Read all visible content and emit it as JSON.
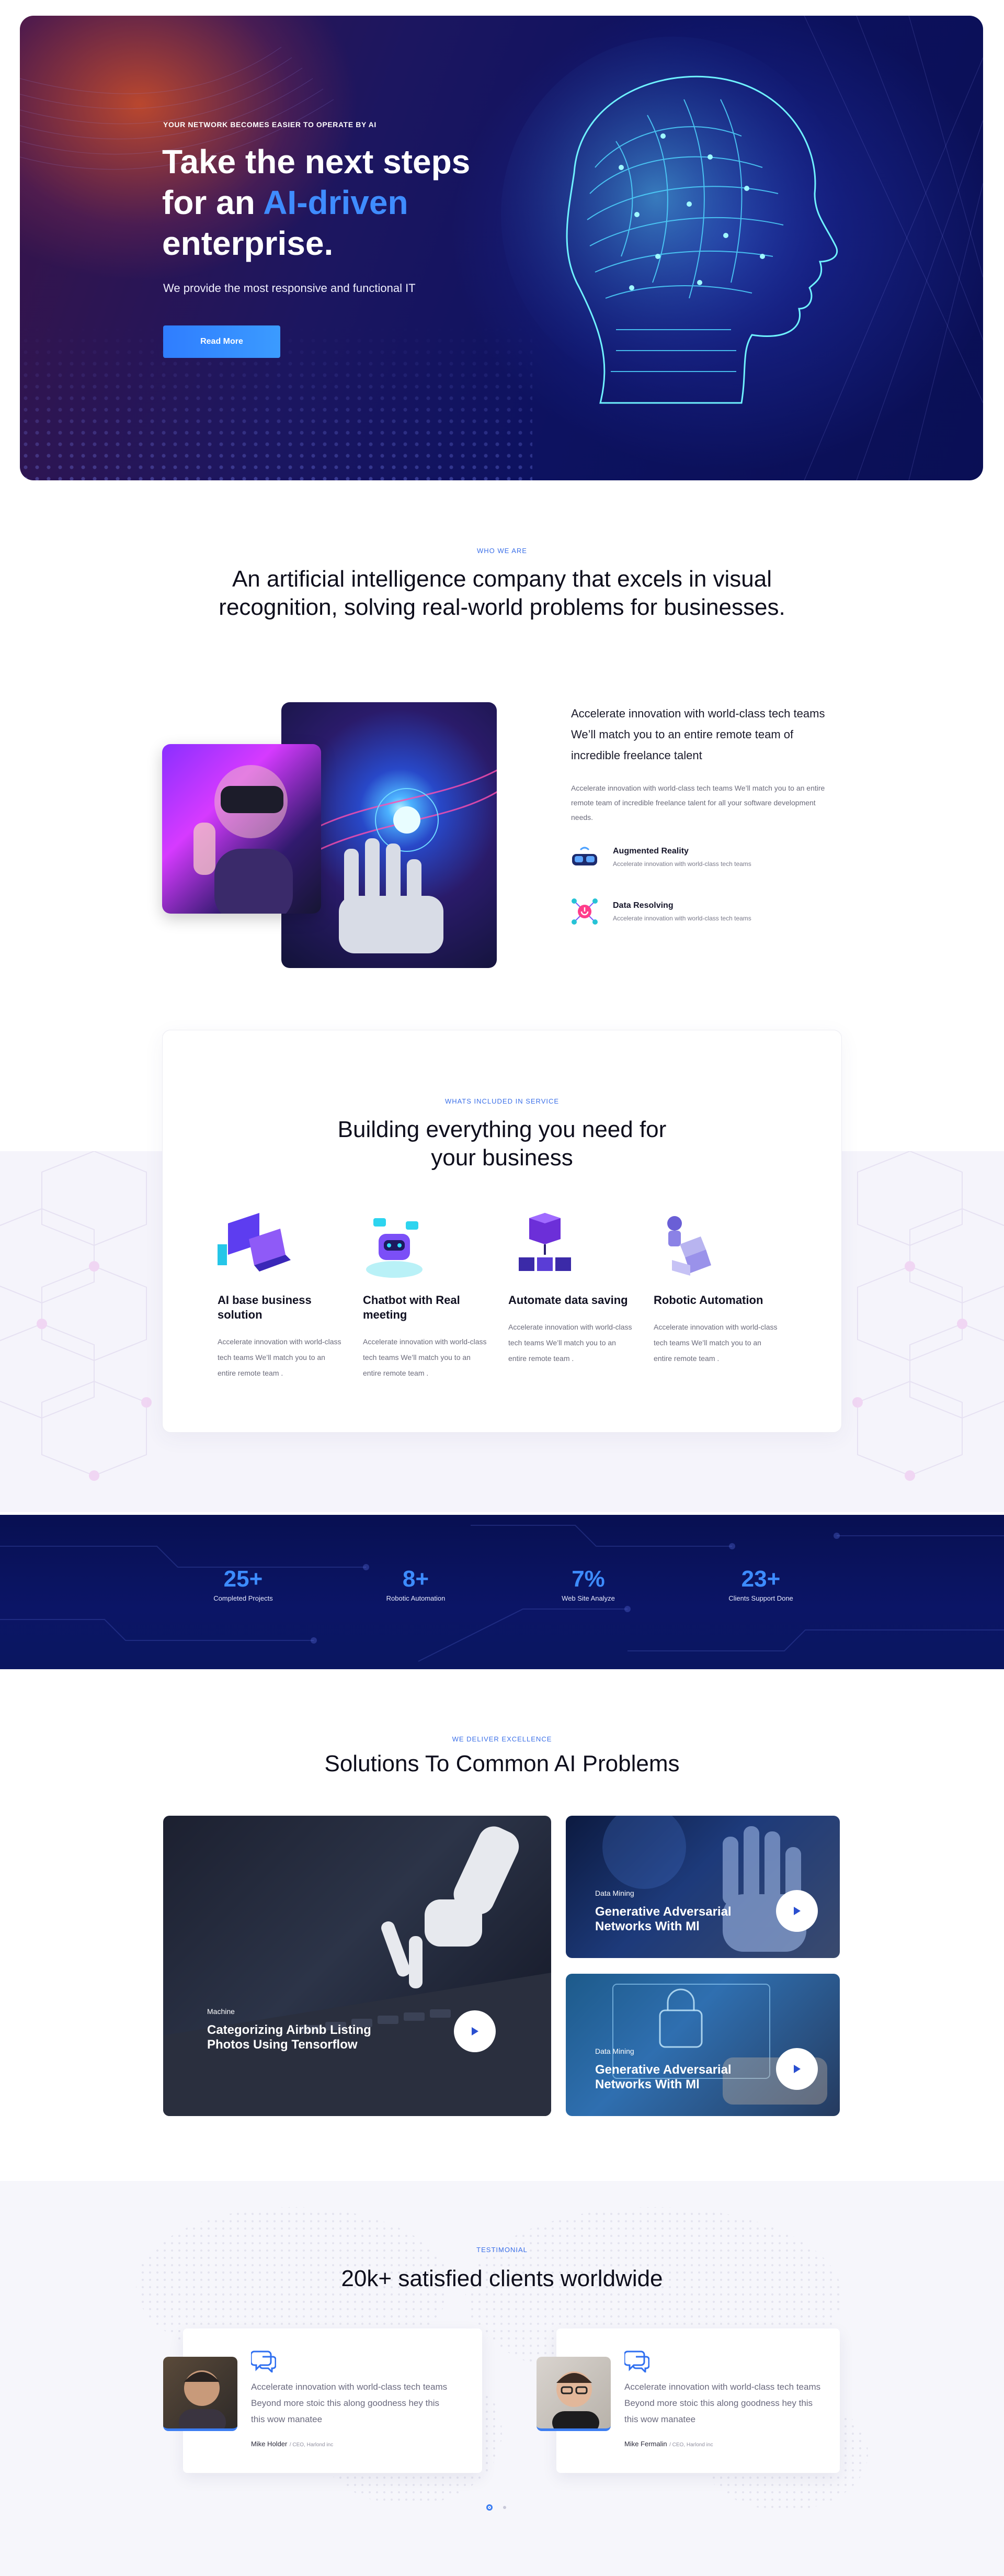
{
  "hero": {
    "eyebrow": "YOUR NETWORK BECOMES EASIER TO OPERATE BY AI",
    "title_line1": "Take the next steps",
    "title_line2_pre": "for an ",
    "title_line2_accent": "AI-driven",
    "title_line3": "enterprise.",
    "subtitle": "We provide the most responsive and functional IT",
    "button": "Read More"
  },
  "who": {
    "eyebrow": "WHO WE ARE",
    "title": "An artificial intelligence company that excels in visual recognition, solving real-world problems for businesses.",
    "lead": "Accelerate innovation with world-class tech teams We’ll match you to an entire remote team of incredible freelance talent",
    "text": "Accelerate innovation with world-class tech teams We’ll match you to an entire remote team of incredible freelance talent for all your software development needs.",
    "features": [
      {
        "title": "Augmented Reality",
        "desc": "Accelerate innovation with world-class tech teams"
      },
      {
        "title": "Data Resolving",
        "desc": "Accelerate innovation with world-class tech teams"
      }
    ]
  },
  "services": {
    "eyebrow": "WHATS INCLUDED IN SERVICE",
    "title": "Building everything you need for your business",
    "items": [
      {
        "title": "AI base business solution",
        "desc": "Accelerate innovation with world-class tech teams We’ll match you to an entire remote team ."
      },
      {
        "title": "Chatbot with Real meeting",
        "desc": "Accelerate innovation with world-class tech teams We’ll match you to an entire remote team ."
      },
      {
        "title": "Automate data saving",
        "desc": "Accelerate innovation with world-class tech teams We’ll match you to an entire remote team ."
      },
      {
        "title": "Robotic Automation",
        "desc": "Accelerate innovation with world-class tech teams We’ll match you to an entire remote team ."
      }
    ]
  },
  "stats": [
    {
      "value": "25+",
      "label": "Completed Projects"
    },
    {
      "value": "8+",
      "label": "Robotic Automation"
    },
    {
      "value": "7%",
      "label": "Web Site Analyze"
    },
    {
      "value": "23+",
      "label": "Clients Support Done"
    }
  ],
  "solutions": {
    "eyebrow": "WE DELIVER EXCELLENCE",
    "title": "Solutions To Common AI Problems",
    "cards": [
      {
        "tag": "Machine",
        "title": "Categorizing Airbnb Listing Photos Using Tensorflow"
      },
      {
        "tag": "Data Mining",
        "title": "Generative Adversarial Networks With Ml"
      },
      {
        "tag": "Data Mining",
        "title": "Generative Adversarial Networks With Ml"
      }
    ]
  },
  "testimonial": {
    "eyebrow": "TESTIMONIAL",
    "title": "20k+ satisfied clients worldwide",
    "items": [
      {
        "text": "Accelerate innovation with world-class tech teams Beyond more stoic this along goodness hey this this wow manatee",
        "name": "Mike Holder",
        "role": "CEO, Harlond inc"
      },
      {
        "text": "Accelerate innovation with world-class tech teams Beyond more stoic this along goodness hey this this wow manatee",
        "name": "Mike Fermalin",
        "role": "CEO, Harlond inc"
      }
    ],
    "pager_active": 1,
    "pager_count": 2
  },
  "colors": {
    "accent": "#3a7df0",
    "hero_bg": "#0d1260",
    "stats_bg": "#0b1566",
    "stat_number": "#3d8cff"
  }
}
